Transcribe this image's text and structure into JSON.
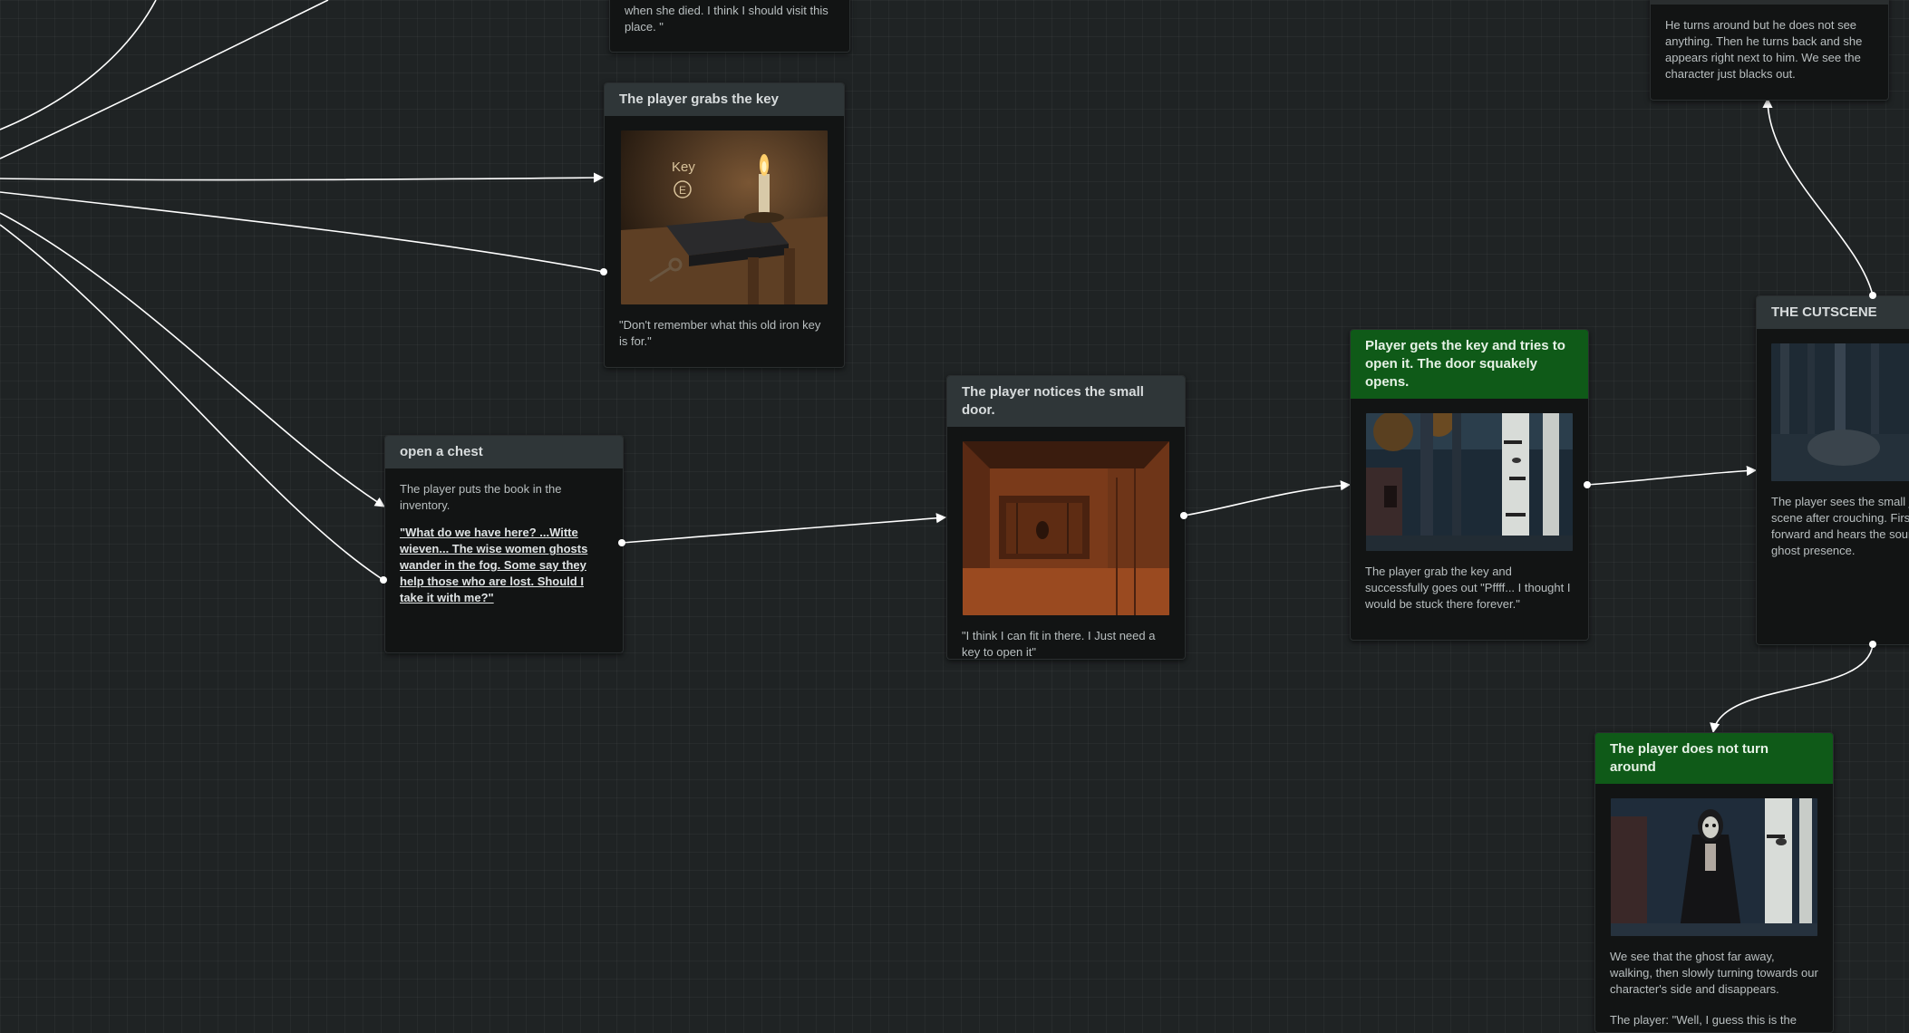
{
  "nodes": {
    "top_partial": {
      "text": "when she died. I think I should visit this place. \""
    },
    "grabs_key": {
      "title": "The player grabs the key",
      "image": "candle-book-key-on-table",
      "image_label": "Key",
      "image_prompt": "E",
      "text": "\"Don't remember what this old iron key is for.\""
    },
    "open_chest": {
      "title": "open a chest",
      "text": "The player puts the book in the inventory.",
      "quote": "\"What do we have here? ...Witte wieven... The wise women ghosts wander in the fog. Some say they help those who are lost. Should I take it with me?\""
    },
    "small_door": {
      "title": "The player notices the small door.",
      "image": "small-wooden-door",
      "text": "\"I think I can fit in there. I Just need a key to open it\""
    },
    "door_opens": {
      "title": "Player gets the key and tries to open it. The door squakely opens.",
      "image": "dark-forest-birch-trees",
      "text": "The player grab the key and successfully goes out \"Pffff... I thought I would be stuck there forever.\""
    },
    "cutscene": {
      "title": "THE CUTSCENE",
      "image": "forest-clearing-with-rock",
      "text": "The player sees the small j scene after crouching. First forward and hears the soun ghost presence."
    },
    "turns_around": {
      "text": "He turns around but he does not see anything. Then he turns back and she appears right next to him. We see the character just blacks out."
    },
    "not_turn": {
      "title": "The player does not turn around",
      "image": "ghost-woman-in-forest",
      "text": "We see that the ghost far away, walking, then slowly turning towards our character's side and disappears.",
      "text2": "The player: \"Well, I guess this is the"
    }
  },
  "colors": {
    "background": "#1f2324",
    "node": "#121414",
    "header": "#2f3638",
    "header_green": "#0f5a18",
    "edge": "#ffffff"
  }
}
